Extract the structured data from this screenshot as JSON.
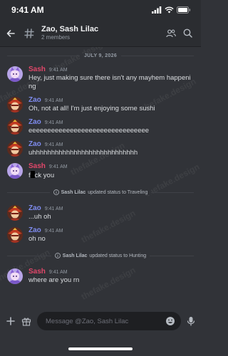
{
  "status_bar": {
    "time": "9:41 AM"
  },
  "header": {
    "title": "Zao, Sash Lilac",
    "subtitle": "2 members"
  },
  "date_divider": "JULY 9, 2026",
  "messages": [
    {
      "author": "Sash",
      "time": "9:41 AM",
      "text": "Hey, just making sure there isn't any mayhem happening"
    },
    {
      "author": "Zao",
      "time": "9:41 AM",
      "text": "Oh, not at all! I'm just enjoying some sushi"
    },
    {
      "author": "Zao",
      "time": "9:41 AM",
      "text": "eeeeeeeeeeeeeeeeeeeeeeeeeeeeeeee"
    },
    {
      "author": "Zao",
      "time": "9:41 AM",
      "text": "uhhhhhhhhhhhhhhhhhhhhhhhhhhhh"
    },
    {
      "author": "Sash",
      "time": "9:41 AM",
      "text_prefix": "f",
      "text_suffix": "ck you"
    },
    {
      "author": "Zao",
      "time": "9:41 AM",
      "text": "...uh oh"
    },
    {
      "author": "Zao",
      "time": "9:41 AM",
      "text": "oh no"
    },
    {
      "author": "Sash",
      "time": "9:41 AM",
      "text": "where are you rn"
    }
  ],
  "system_events": [
    {
      "name": "Sash Lilac",
      "text": "updated status to Traveling"
    },
    {
      "name": "Sash Lilac",
      "text": "updated status to Hunting"
    }
  ],
  "composer": {
    "placeholder": "Message @Zao, Sash Lilac"
  },
  "watermark": {
    "brand": "thefake.design",
    "tag": "PREVIEW"
  },
  "colors": {
    "background": "#313338",
    "sash_name": "#e2476a",
    "zao_name": "#7f8cf0",
    "input_bg": "#1e1f22"
  },
  "icons": [
    "back-arrow-icon",
    "hash-icon",
    "members-icon",
    "search-icon",
    "plus-icon",
    "gift-icon",
    "emoji-icon",
    "microphone-icon",
    "signal-icon",
    "wifi-icon",
    "battery-icon"
  ]
}
